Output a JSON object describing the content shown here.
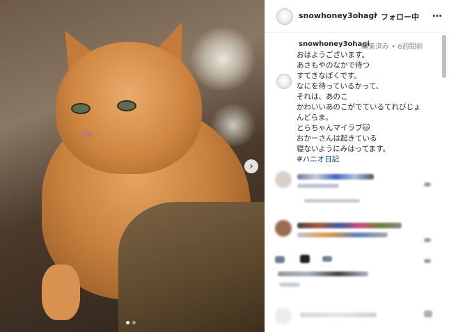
{
  "window": {
    "photo_alt": "",
    "next_icon": "chevron-right-icon",
    "carousel_total": 2,
    "carousel_active": 0
  },
  "header": {
    "username": "snowhoney3ohagi",
    "separator": "•",
    "follow_status": "フォロー中",
    "more_icon": "ellipsis-icon",
    "more_label": "…"
  },
  "caption": {
    "username": "snowhoney3ohagi",
    "edited": "編集済み",
    "dot": "•",
    "time_ago": "6週間前",
    "lines": [
      "おはようございます。",
      "あさもやのなかで待つ",
      "すてきなぼくです。",
      "なにを待っているかって、",
      "それは、あのこ",
      "かわいいあのこがでているてれびじょ",
      "んどらま。",
      "とらちゃんマイラブ🐱",
      "おかーさんは起きている",
      "寝ないようにみはってます。"
    ],
    "hashtag": "#ハニオ日記"
  },
  "colors": {
    "text": "#262626",
    "muted": "#8e8e8e",
    "link": "#00376b",
    "border": "#efefef"
  }
}
